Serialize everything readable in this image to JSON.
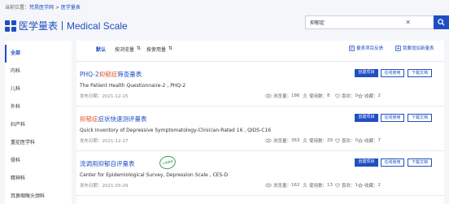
{
  "breadcrumb": {
    "prefix": "当前位置：",
    "site": "梵昊医学网",
    "sep": " > ",
    "current": "医学量表"
  },
  "logo": {
    "cn": "医学量表",
    "en": "Medical Scale"
  },
  "search": {
    "value": "抑郁症",
    "placeholder": ""
  },
  "sidebar": {
    "items": [
      {
        "label": "全部",
        "active": true
      },
      {
        "label": "内科"
      },
      {
        "label": "儿科"
      },
      {
        "label": "外科"
      },
      {
        "label": "妇产科"
      },
      {
        "label": "重症医学科"
      },
      {
        "label": "骨科"
      },
      {
        "label": "精神科"
      },
      {
        "label": "耳鼻咽喉头颈科"
      }
    ]
  },
  "filters": {
    "default": "默认",
    "by_views": "按浏览量",
    "by_usage": "按使用量"
  },
  "toolbar": {
    "feedback": "量表项目反馈",
    "add_scale": "我要增加新量表"
  },
  "labels": {
    "publish_date": "发布日期：",
    "views": "浏览量：",
    "usage": "使用数：",
    "likes": "喜欢：",
    "favorites": "收藏："
  },
  "buttons": {
    "create": "创建项目",
    "online": "在线使用",
    "download": "下载文档"
  },
  "scales": [
    {
      "title_pre": "PHQ-2",
      "title_hl": "抑郁症",
      "title_post": "筛查量表",
      "en": "The Patient Health Questionnaire-2 , PHQ-2",
      "date": "2021-12-15",
      "views": "186",
      "usage": "8",
      "likes": "0",
      "favorites": "2"
    },
    {
      "title_pre": "",
      "title_hl": "抑郁症",
      "title_post": "症状快速测评量表",
      "en": "Quick Inventory of Depressive Symptomatology-Clinician-Rated 16 , QIDS-C16",
      "date": "2021-12-17",
      "views": "363",
      "usage": "29",
      "likes": "0",
      "favorites": "7"
    },
    {
      "title_pre": "",
      "title_hl": "",
      "title_post": "流调用抑郁自评量表",
      "stamp": "心理量表",
      "en": "Center for Epidemiological Survey, Depression Scale , CES-D",
      "date": "2021-03-29",
      "views": "162",
      "usage": "13",
      "likes": "1",
      "favorites": "2"
    }
  ],
  "colors": {
    "accent": "#1f4fc2",
    "highlight": "#e2542a",
    "stamp": "#3e9e5a",
    "background": "#f4f6f9"
  }
}
